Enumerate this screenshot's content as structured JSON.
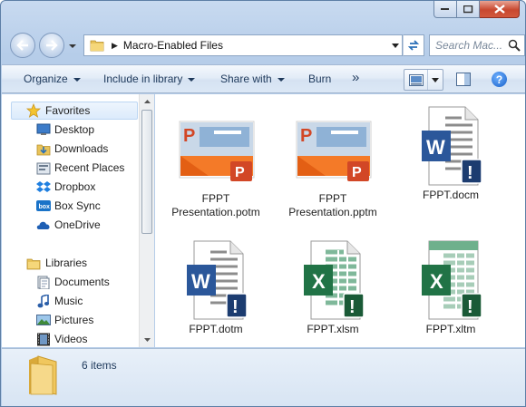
{
  "address": {
    "path": "Macro-Enabled Files",
    "search_placeholder": "Search Mac..."
  },
  "toolbar": {
    "organize": "Organize",
    "include": "Include in library",
    "share": "Share with",
    "burn": "Burn",
    "more": "»"
  },
  "nav": {
    "favorites": "Favorites",
    "desktop": "Desktop",
    "downloads": "Downloads",
    "recent": "Recent Places",
    "dropbox": "Dropbox",
    "boxsync": "Box Sync",
    "onedrive": "OneDrive",
    "libraries": "Libraries",
    "documents": "Documents",
    "music": "Music",
    "pictures": "Pictures",
    "videos": "Videos"
  },
  "files": [
    {
      "name": "FPPT Presentation.potm",
      "type": "potm"
    },
    {
      "name": "FPPT Presentation.pptm",
      "type": "pptm"
    },
    {
      "name": "FPPT.docm",
      "type": "docm"
    },
    {
      "name": "FPPT.dotm",
      "type": "dotm"
    },
    {
      "name": "FPPT.xlsm",
      "type": "xlsm"
    },
    {
      "name": "FPPT.xltm",
      "type": "xltm"
    }
  ],
  "status": {
    "count": "6 items"
  },
  "colors": {
    "word": "#2b579a",
    "excel": "#217346",
    "powerpoint": "#d24726",
    "warning_badge": "#1c3c70"
  }
}
